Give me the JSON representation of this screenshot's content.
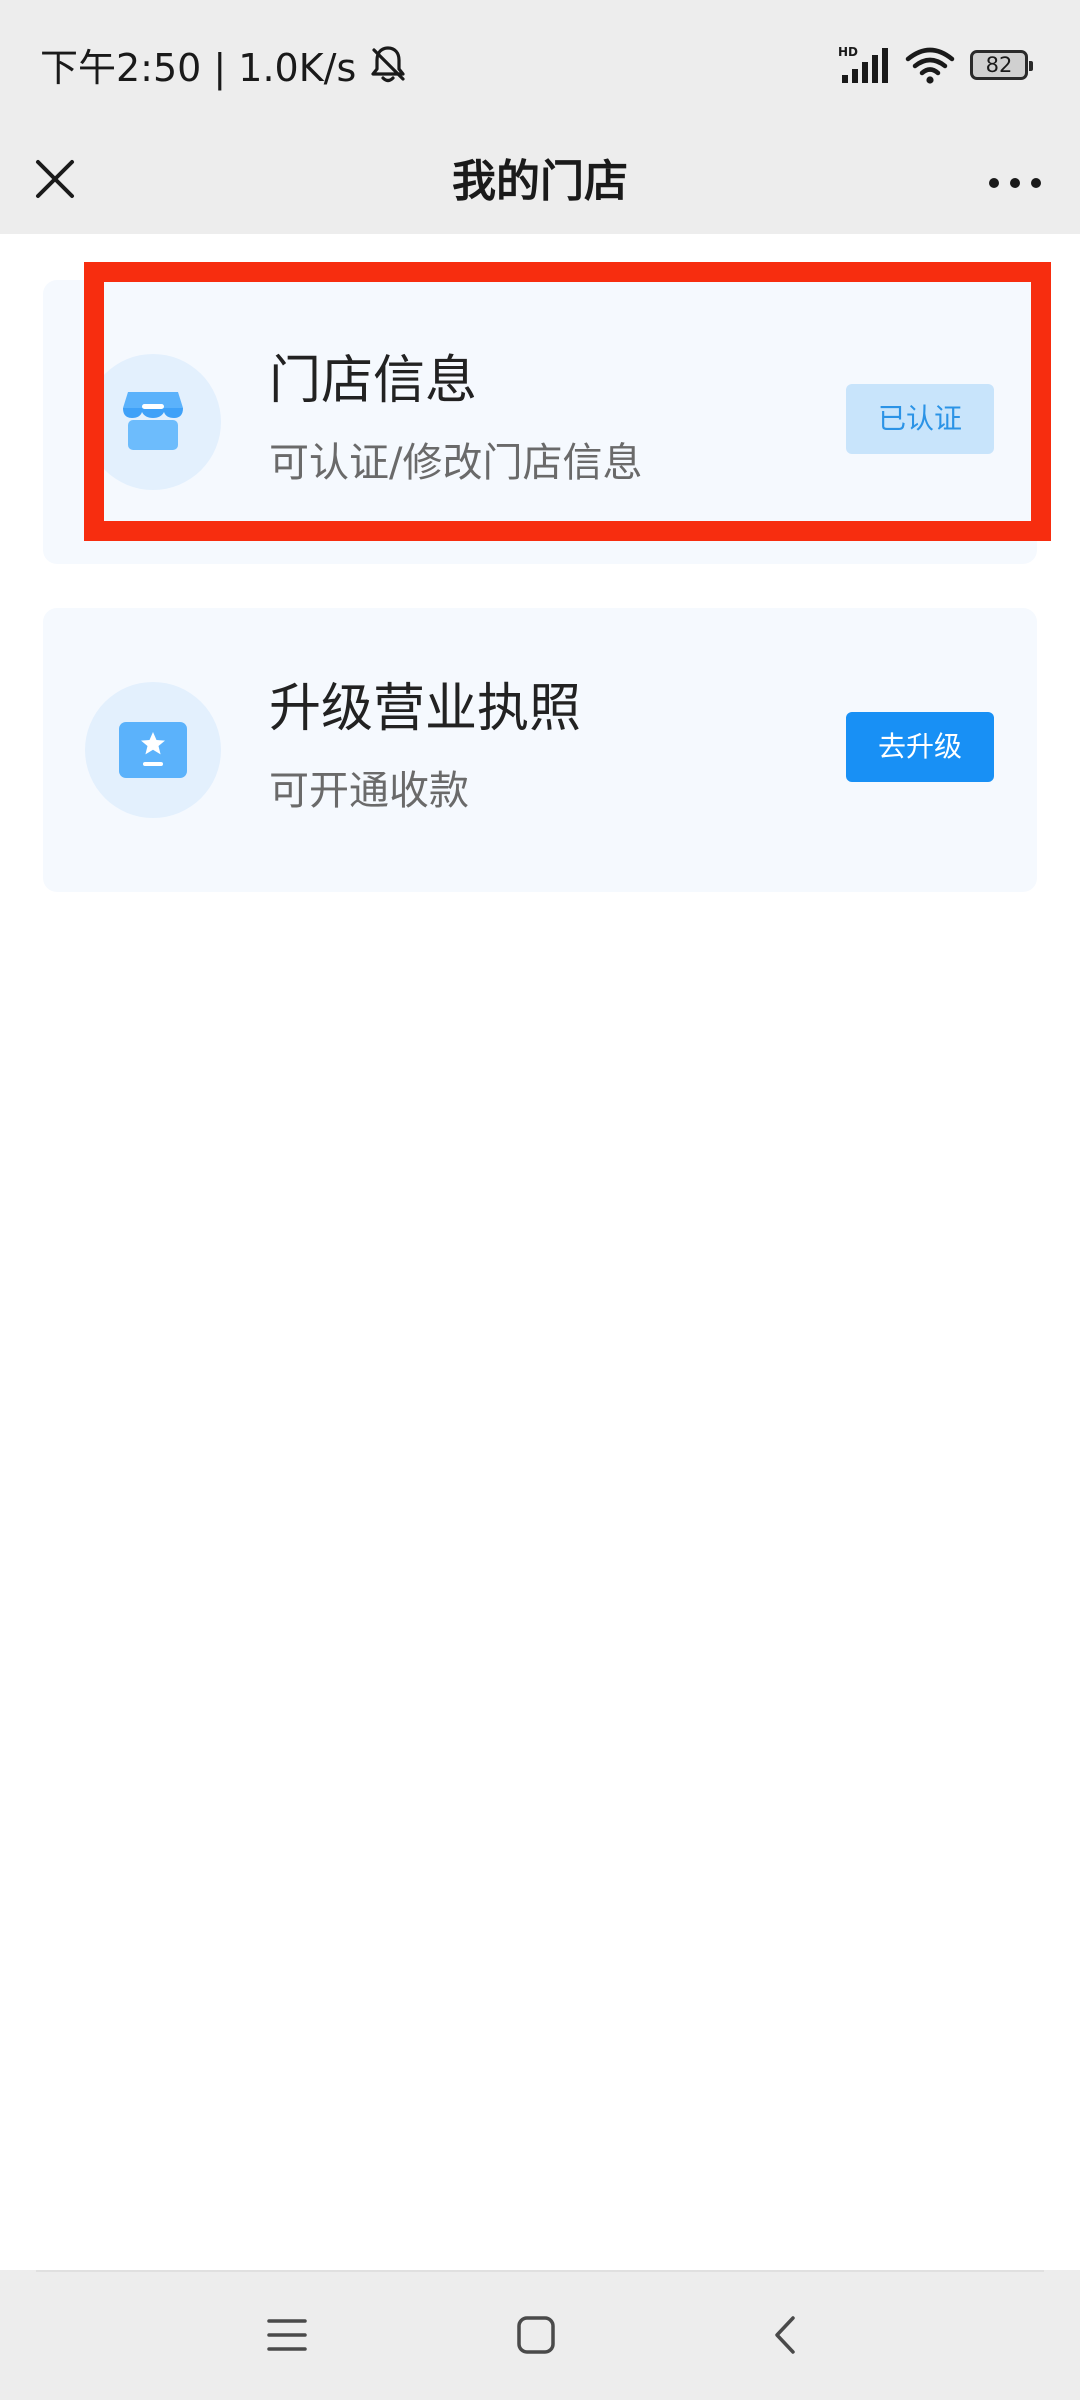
{
  "status_bar": {
    "time_speed": "下午2:50 | 1.0K/s",
    "network_badge": "HD",
    "battery_level": "82",
    "icons": [
      "mute-bell-icon",
      "signal-icon",
      "wifi-icon",
      "battery-icon"
    ]
  },
  "nav": {
    "title": "我的门店",
    "icons": [
      "close-icon",
      "more-icon"
    ]
  },
  "cards": [
    {
      "icon": "store-icon",
      "title": "门店信息",
      "subtitle": "可认证/修改门店信息",
      "button": "已认证"
    },
    {
      "icon": "license-star-icon",
      "title": "升级营业执照",
      "subtitle": "可开通收款",
      "button": "去升级"
    }
  ],
  "system_nav": {
    "icons": [
      "menu-icon",
      "home-icon",
      "back-icon"
    ]
  },
  "colors": {
    "accent": "#1890f5",
    "highlight": "#f72d0f",
    "card_bg": "#f5f9fe",
    "header_bg": "#ededed"
  }
}
